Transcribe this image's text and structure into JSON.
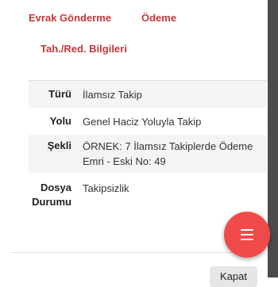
{
  "tabs": {
    "tab1": "Evrak Gönderme",
    "tab2": "Ödeme",
    "tab3": "Tah./Red. Bilgileri"
  },
  "details": {
    "rows": [
      {
        "label": "Türü",
        "value": "İlamsız Takip"
      },
      {
        "label": "Yolu",
        "value": "Genel Haciz Yoluyla Takip"
      },
      {
        "label": "Şekli",
        "value": "ÖRNEK: 7 İlamsız Takiplerde Ödeme Emri - Eski No: 49"
      },
      {
        "label": "Dosya Durumu",
        "value": "Takipsizlik"
      }
    ]
  },
  "footer": {
    "close_label": "Kapat"
  },
  "colors": {
    "accent": "#c0393b",
    "fab": "#f04a4a"
  },
  "icons": {
    "fab_icon": "menu-icon"
  }
}
